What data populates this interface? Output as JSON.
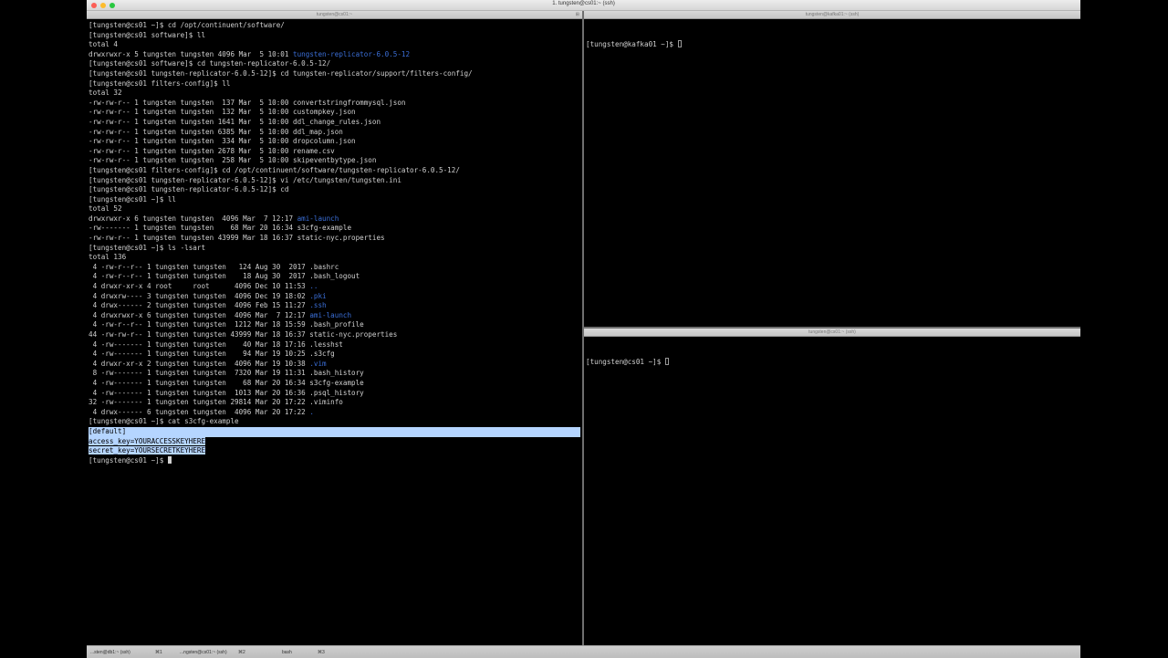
{
  "window": {
    "title": "1. tungsten@cs01:~ (ssh)"
  },
  "panes": {
    "left": {
      "header_title": "tungsten@cs01:~",
      "split_icon": "⊞",
      "lines": [
        [
          {
            "t": "[tungsten@cs01 ~]$ cd /opt/continuent/software/"
          }
        ],
        [
          {
            "t": "[tungsten@cs01 software]$ ll"
          }
        ],
        [
          {
            "t": "total 4"
          }
        ],
        [
          {
            "t": "drwxrwxr-x 5 tungsten tungsten 4096 Mar  5 10:01 "
          },
          {
            "t": "tungsten-replicator-6.0.5-12",
            "c": "dir"
          }
        ],
        [
          {
            "t": "[tungsten@cs01 software]$ cd tungsten-replicator-6.0.5-12/"
          }
        ],
        [
          {
            "t": "[tungsten@cs01 tungsten-replicator-6.0.5-12]$ cd tungsten-replicator/support/filters-config/"
          }
        ],
        [
          {
            "t": "[tungsten@cs01 filters-config]$ ll"
          }
        ],
        [
          {
            "t": "total 32"
          }
        ],
        [
          {
            "t": "-rw-rw-r-- 1 tungsten tungsten  137 Mar  5 10:00 convertstringfrommysql.json"
          }
        ],
        [
          {
            "t": "-rw-rw-r-- 1 tungsten tungsten  132 Mar  5 10:00 custompkey.json"
          }
        ],
        [
          {
            "t": "-rw-rw-r-- 1 tungsten tungsten 1641 Mar  5 10:00 ddl_change_rules.json"
          }
        ],
        [
          {
            "t": "-rw-rw-r-- 1 tungsten tungsten 6385 Mar  5 10:00 ddl_map.json"
          }
        ],
        [
          {
            "t": "-rw-rw-r-- 1 tungsten tungsten  334 Mar  5 10:00 dropcolumn.json"
          }
        ],
        [
          {
            "t": "-rw-rw-r-- 1 tungsten tungsten 2678 Mar  5 10:00 rename.csv"
          }
        ],
        [
          {
            "t": "-rw-rw-r-- 1 tungsten tungsten  258 Mar  5 10:00 skipeventbytype.json"
          }
        ],
        [
          {
            "t": "[tungsten@cs01 filters-config]$ cd /opt/continuent/software/tungsten-replicator-6.0.5-12/"
          }
        ],
        [
          {
            "t": "[tungsten@cs01 tungsten-replicator-6.0.5-12]$ vi /etc/tungsten/tungsten.ini"
          }
        ],
        [
          {
            "t": "[tungsten@cs01 tungsten-replicator-6.0.5-12]$ cd"
          }
        ],
        [
          {
            "t": "[tungsten@cs01 ~]$ ll"
          }
        ],
        [
          {
            "t": "total 52"
          }
        ],
        [
          {
            "t": "drwxrwxr-x 6 tungsten tungsten  4096 Mar  7 12:17 "
          },
          {
            "t": "ami-launch",
            "c": "dir"
          }
        ],
        [
          {
            "t": "-rw------- 1 tungsten tungsten    68 Mar 20 16:34 s3cfg-example"
          }
        ],
        [
          {
            "t": "-rw-rw-r-- 1 tungsten tungsten 43999 Mar 18 16:37 static-nyc.properties"
          }
        ],
        [
          {
            "t": "[tungsten@cs01 ~]$ ls -lsart"
          }
        ],
        [
          {
            "t": "total 136"
          }
        ],
        [
          {
            "t": " 4 -rw-r--r-- 1 tungsten tungsten   124 Aug 30  2017 .bashrc"
          }
        ],
        [
          {
            "t": " 4 -rw-r--r-- 1 tungsten tungsten    18 Aug 30  2017 .bash_logout"
          }
        ],
        [
          {
            "t": " 4 drwxr-xr-x 4 root     root      4096 Dec 10 11:53 "
          },
          {
            "t": "..",
            "c": "dir"
          }
        ],
        [
          {
            "t": " 4 drwxrw---- 3 tungsten tungsten  4096 Dec 19 18:02 "
          },
          {
            "t": ".pki",
            "c": "dir"
          }
        ],
        [
          {
            "t": " 4 drwx------ 2 tungsten tungsten  4096 Feb 15 11:27 "
          },
          {
            "t": ".ssh",
            "c": "dir"
          }
        ],
        [
          {
            "t": " 4 drwxrwxr-x 6 tungsten tungsten  4096 Mar  7 12:17 "
          },
          {
            "t": "ami-launch",
            "c": "dir"
          }
        ],
        [
          {
            "t": " 4 -rw-r--r-- 1 tungsten tungsten  1212 Mar 18 15:59 .bash_profile"
          }
        ],
        [
          {
            "t": "44 -rw-rw-r-- 1 tungsten tungsten 43999 Mar 18 16:37 static-nyc.properties"
          }
        ],
        [
          {
            "t": " 4 -rw------- 1 tungsten tungsten    40 Mar 18 17:16 .lesshst"
          }
        ],
        [
          {
            "t": " 4 -rw------- 1 tungsten tungsten    94 Mar 19 10:25 .s3cfg"
          }
        ],
        [
          {
            "t": " 4 drwxr-xr-x 2 tungsten tungsten  4096 Mar 19 10:38 "
          },
          {
            "t": ".vim",
            "c": "dir"
          }
        ],
        [
          {
            "t": " 8 -rw------- 1 tungsten tungsten  7320 Mar 19 11:31 .bash_history"
          }
        ],
        [
          {
            "t": " 4 -rw------- 1 tungsten tungsten    68 Mar 20 16:34 s3cfg-example"
          }
        ],
        [
          {
            "t": " 4 -rw------- 1 tungsten tungsten  1013 Mar 20 16:36 .psql_history"
          }
        ],
        [
          {
            "t": "32 -rw------- 1 tungsten tungsten 29814 Mar 20 17:22 .viminfo"
          }
        ],
        [
          {
            "t": " 4 drwx------ 6 tungsten tungsten  4096 Mar 20 17:22 "
          },
          {
            "t": ".",
            "c": "dir"
          }
        ],
        [
          {
            "t": "[tungsten@cs01 ~]$ cat s3cfg-example"
          }
        ],
        [
          {
            "t": "[default]",
            "c": "selected-full"
          }
        ],
        [
          {
            "t": "access_key=YOURACCESSKEYHERE",
            "c": "selected"
          }
        ],
        [
          {
            "t": "secret_key=YOURSECRETKEYHERE",
            "c": "selected"
          }
        ],
        [
          {
            "t": "[tungsten@cs01 ~]$ "
          }
        ]
      ]
    },
    "top_right": {
      "header_title": "tungsten@kafka01:~ (ssh)",
      "prompt": "[tungsten@kafka01 ~]$ "
    },
    "bottom_right": {
      "header_title": "tungsten@cs01:~ (ssh)",
      "prompt": "[tungsten@cs01 ~]$ "
    }
  },
  "tabs": [
    {
      "label": "...sten@db1:~ (ssh)",
      "shortcut": "⌘1"
    },
    {
      "label": "...ngsten@cs01:~ (ssh)",
      "shortcut": "⌘2"
    },
    {
      "label": "bash",
      "shortcut": "⌘3"
    }
  ]
}
